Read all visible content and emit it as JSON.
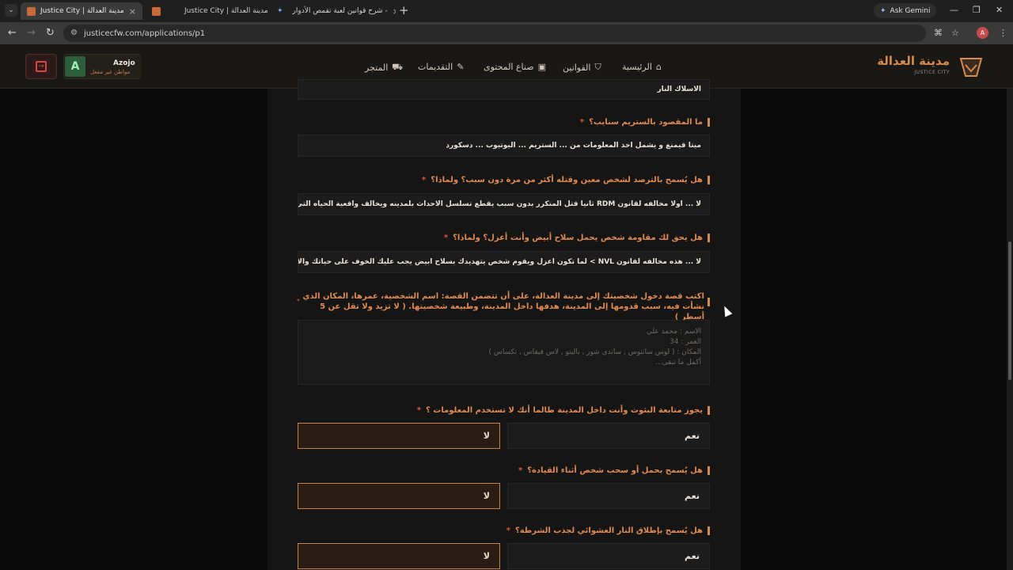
{
  "browser": {
    "tabs": [
      {
        "title": "Justice City | مدينة العدالة",
        "active": true
      },
      {
        "title": "Justice City | مدينة العدالة",
        "active": false
      },
      {
        "title": "شرح قوانين لعبة تقمص الأدوار -",
        "active": false
      }
    ],
    "ask_gemini": "Ask Gemini",
    "url": "justicecfw.com/applications/p1",
    "profile_initial": "A"
  },
  "header": {
    "logo_title": "مدينة العدالة",
    "logo_sub": "JUSTICE CITY",
    "nav": {
      "home": "الرئيسية",
      "rules": "القوانين",
      "creators": "صناع المحتوى",
      "applications": "التقديمات",
      "store": "المتجر"
    },
    "user": {
      "name": "Azojo",
      "status": "مواطن غير مفعل",
      "avatar_letter": "A"
    }
  },
  "form": {
    "partial_answer": "الاسلاك النار",
    "q1": {
      "label": "ما المقصود بالستريم سنايب؟",
      "answer": "ميتا قيمنغ و يشمل اخذ المعلومات من ... الستريم ... اليوتيوب ... دسكورد"
    },
    "q2": {
      "label": "هل يُسمح بالترصد لشخص معين وقتله أكثر من مرة دون سبب؟ ولماذا؟",
      "answer": "لا ... اولا مخالفه لقانون RDM ثانيا قتل المتكرر بدون سبب يقطع تسلسل الاحداث بلمدينه ويخالف واقعية الحياه التي تعتمد ع"
    },
    "q3": {
      "label": "هل يحق لك مقاومة شخص يحمل سلاح أبيض وأنت أعزل؟ ولماذا؟",
      "answer": "لا ... هذه مخالفه لقانون NVL > لما تكون اعزل ويقوم شخص يتهديدك بسلاح ابيض يجب عليك الخوف على حياتك والاستجابه لا"
    },
    "story": {
      "label": "اكتب قصة دخول شخصيتك إلى مدينة العدالة، على أن تتضمن القصة: اسم الشخصية، عمرها، المكان الذي نشأت فيه، سبب قدومها إلى المدينة، هدفها داخل المدينة، وطبيعة شخصيتها. ( لا تزيد ولا تقل عن 5 أسطر )",
      "placeholder_lines": [
        "الاسم : محمد علي",
        "العمر : 34",
        "المكان : ( لوس سانتوس , ساندي شور , باليتو , لاس فيقاس , تكساس )",
        "أكمل ما تبقى..."
      ]
    },
    "q4": {
      "label": "يجوز متابعة البثوث وأنت داخل المدينة طالما أنك لا تستخدم المعلومات ؟",
      "yes": "نعم",
      "no": "لا",
      "selected": "لا"
    },
    "q5": {
      "label": "هل يُسمح بحمل أو سحب شخص أثناء القيادة؟",
      "yes": "نعم",
      "no": "لا",
      "selected": "لا"
    },
    "q6": {
      "label": "هل يُسمح بإطلاق النار العشوائي لجذب الشرطة؟",
      "yes": "نعم",
      "no": "لا",
      "selected": "لا"
    },
    "required_mark": "*"
  }
}
